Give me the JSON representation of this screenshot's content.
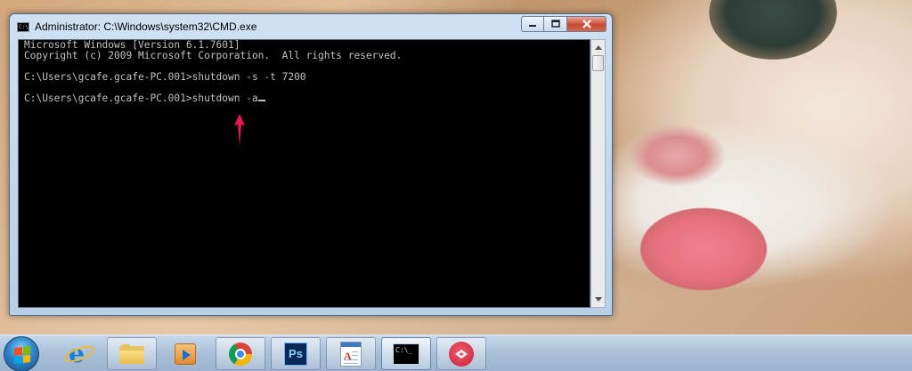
{
  "window": {
    "title": "Administrator: C:\\Windows\\system32\\CMD.exe",
    "icon": "cmd-icon",
    "controls": {
      "minimize": "minimize-icon",
      "maximize": "maximize-icon",
      "close": "close-icon"
    }
  },
  "console": {
    "lines": [
      "Microsoft Windows [Version 6.1.7601]",
      "Copyright (c) 2009 Microsoft Corporation.  All rights reserved.",
      "",
      "C:\\Users\\gcafe.gcafe-PC.001>shutdown -s -t 7200",
      "",
      "C:\\Users\\gcafe.gcafe-PC.001>shutdown -a"
    ],
    "text_color": "#C0C0C0",
    "background": "#000000"
  },
  "annotation": {
    "icon": "red-arrow-icon",
    "color": "#E8174F"
  },
  "taskbar": {
    "start": "windows-start-icon",
    "items": [
      {
        "name": "internet-explorer",
        "icon": "ie-icon",
        "state": "pinned"
      },
      {
        "name": "file-explorer",
        "icon": "folder-icon",
        "state": "open"
      },
      {
        "name": "media-player",
        "icon": "media-player-icon",
        "state": "pinned"
      },
      {
        "name": "chrome",
        "icon": "chrome-icon",
        "state": "open"
      },
      {
        "name": "photoshop",
        "icon": "photoshop-icon",
        "label": "Ps",
        "state": "open"
      },
      {
        "name": "document-app",
        "icon": "document-icon",
        "state": "open"
      },
      {
        "name": "command-prompt",
        "icon": "cmd-icon",
        "state": "active"
      },
      {
        "name": "red-app",
        "icon": "red-circle-app-icon",
        "state": "open"
      }
    ]
  }
}
